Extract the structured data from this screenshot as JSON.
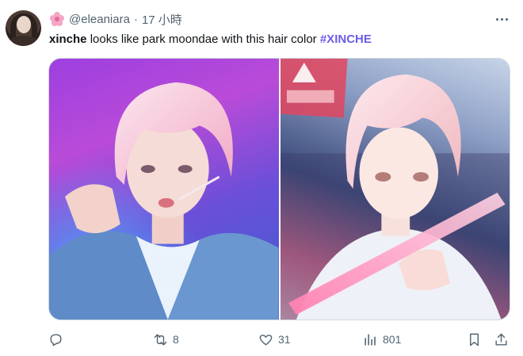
{
  "tweet": {
    "handle": "@eleaniara",
    "separator": "·",
    "time": "17 小時",
    "text_bold": "xinche",
    "text_body": " looks like park moondae with this hair color ",
    "hashtag": "#XINCHE"
  },
  "media": {
    "left_photo": "photo-concert-performer",
    "right_photo": "photo-illustrated-character-danger-sign"
  },
  "actions": {
    "reply_count": "",
    "retweet_count": "8",
    "like_count": "31",
    "views_count": "801"
  },
  "colors": {
    "accent": "#6c5ce7",
    "muted": "#536471",
    "text": "#0f1419",
    "border": "#cfd9de"
  }
}
